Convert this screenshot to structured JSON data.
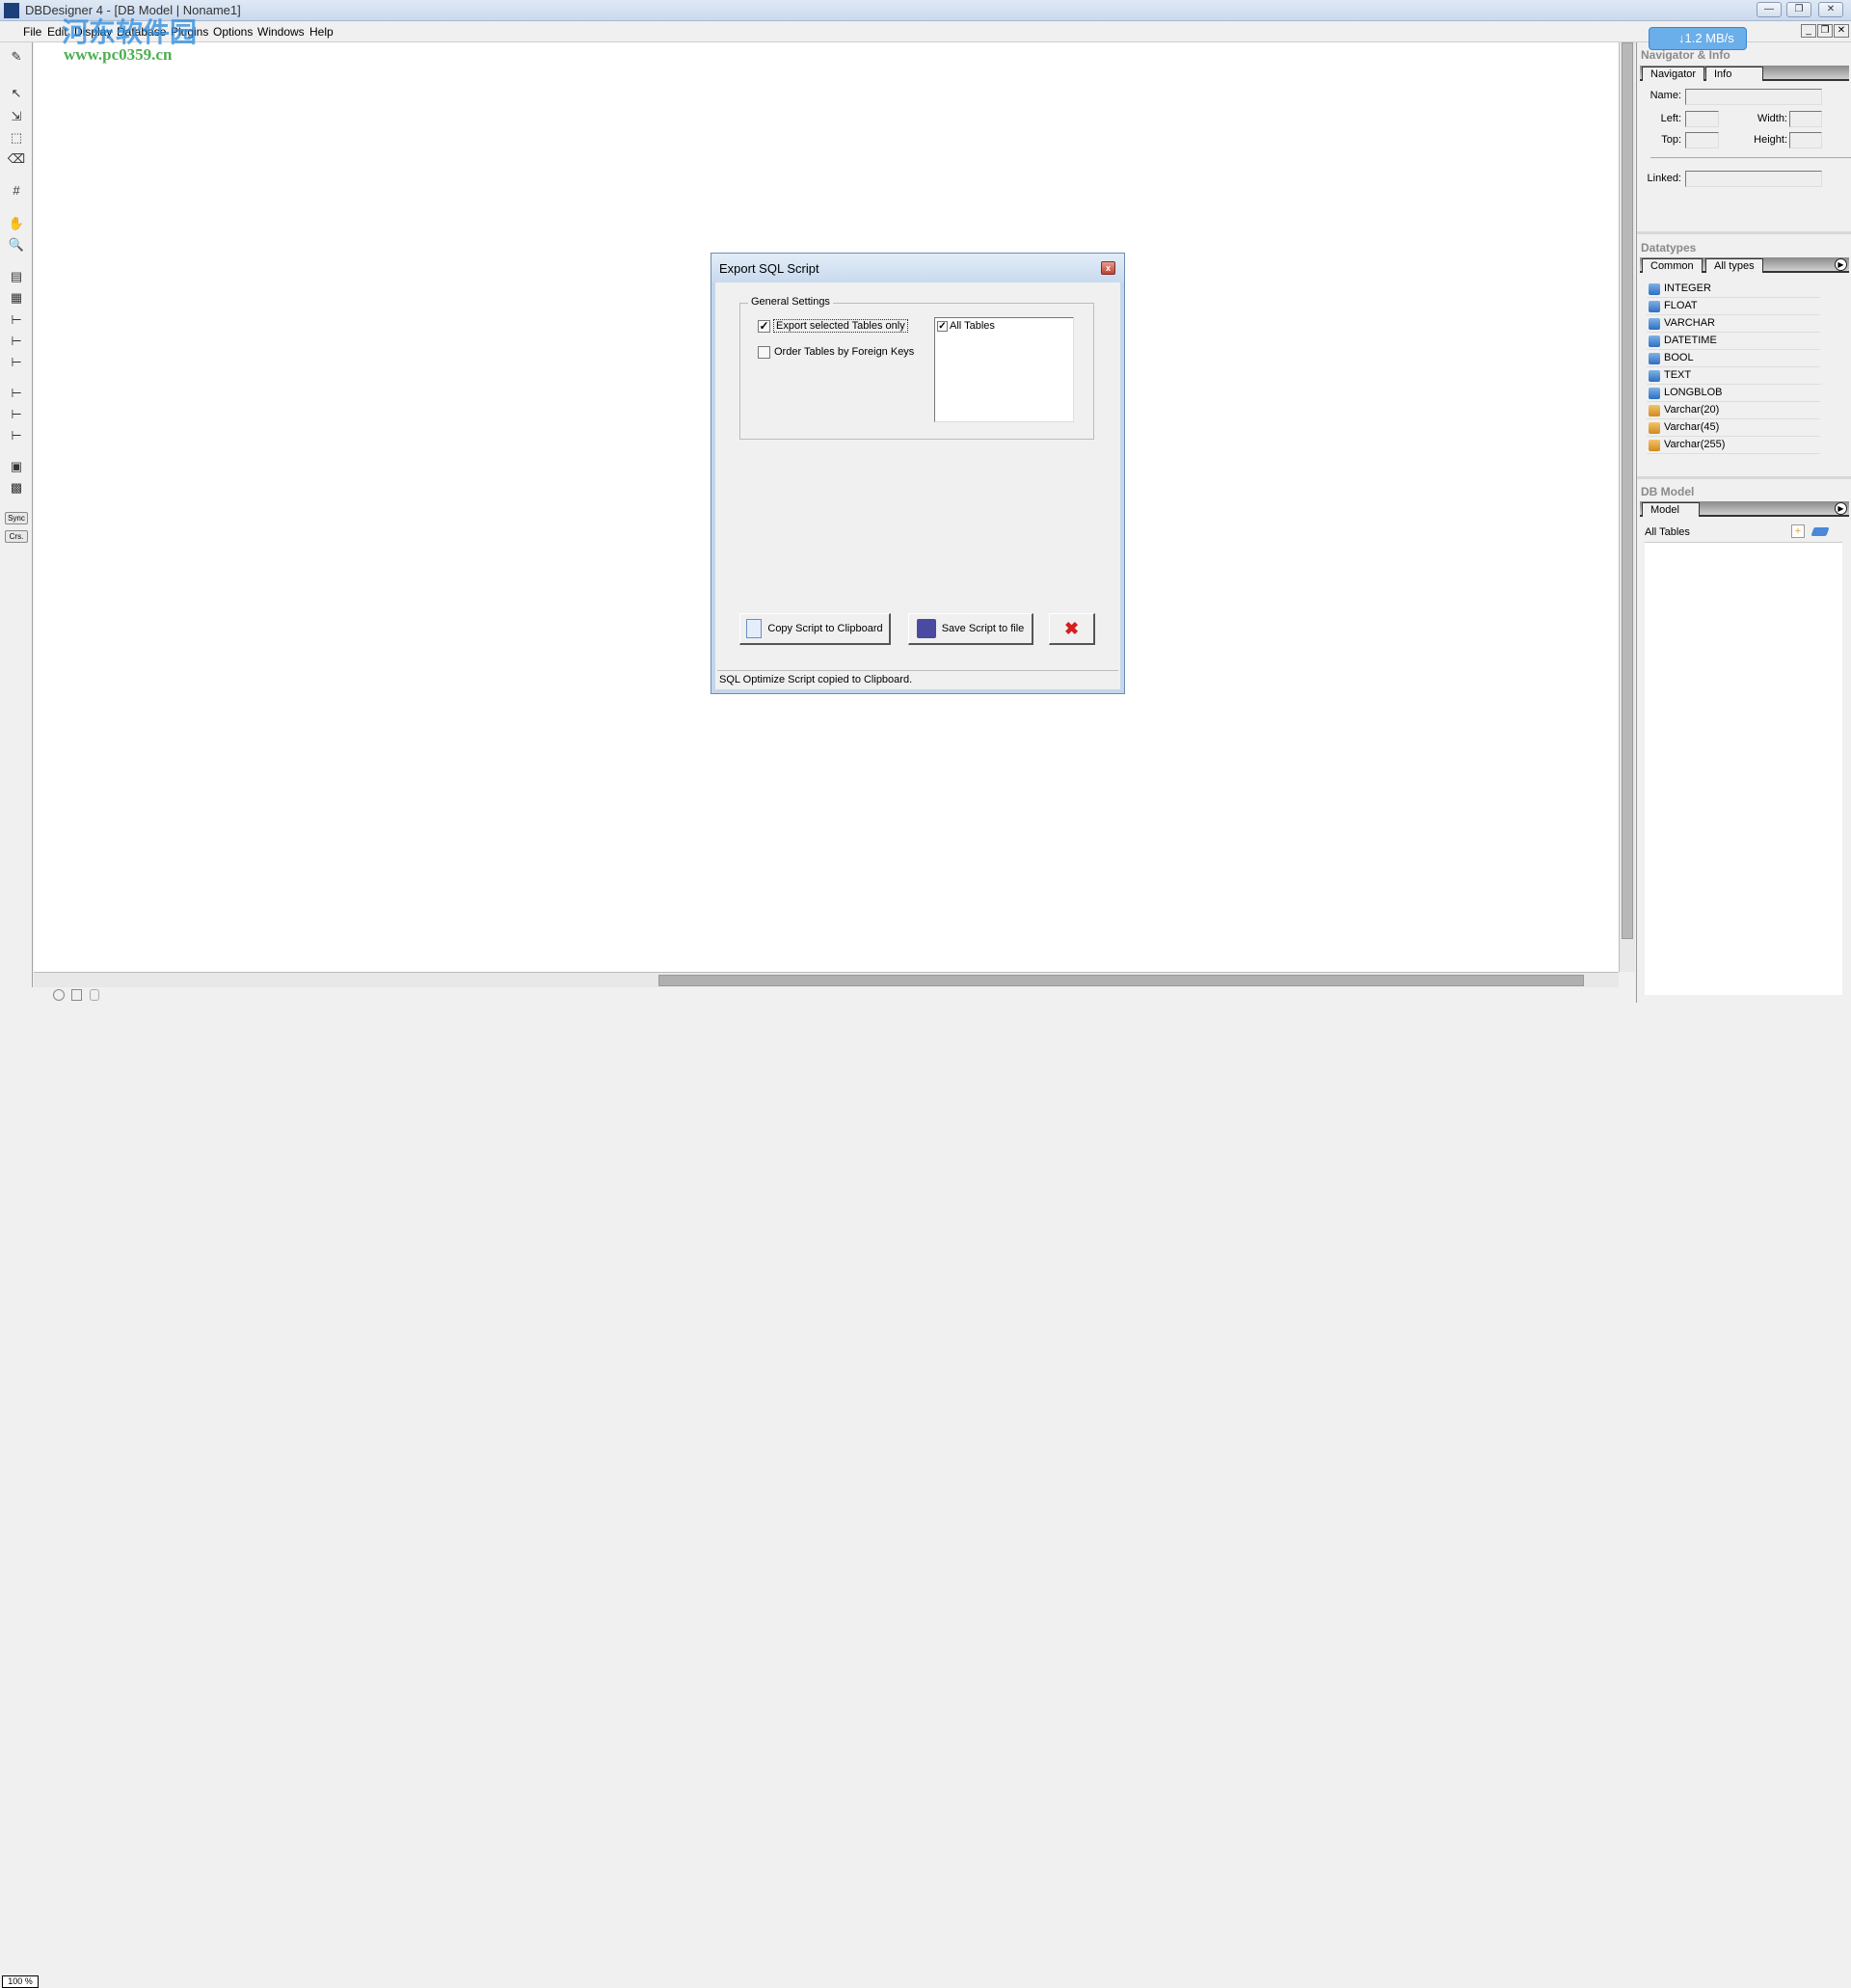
{
  "window": {
    "title": "DBDesigner 4 - [DB Model | Noname1]",
    "min": "—",
    "max": "❐",
    "close": "✕"
  },
  "menu": [
    "File",
    "Edit",
    "Display",
    "Database",
    "Plugins",
    "Options",
    "Windows",
    "Help"
  ],
  "watermark": {
    "text": "河东软件园",
    "url": "www.pc0359.cn"
  },
  "download_badge": "↓1.2 MB/s",
  "toolbar": {
    "sync": "Sync",
    "crs": "Crs."
  },
  "status": {
    "zoom": "100 %"
  },
  "navigator": {
    "header": "Navigator & Info",
    "tabs": [
      "Navigator",
      "Info"
    ],
    "name_label": "Name:",
    "left_label": "Left:",
    "width_label": "Width:",
    "top_label": "Top:",
    "height_label": "Height:",
    "linked_label": "Linked:"
  },
  "datatypes": {
    "header": "Datatypes",
    "tabs": [
      "Common",
      "All types"
    ],
    "items": [
      "INTEGER",
      "FLOAT",
      "VARCHAR",
      "DATETIME",
      "BOOL",
      "TEXT",
      "LONGBLOB",
      "Varchar(20)",
      "Varchar(45)",
      "Varchar(255)"
    ]
  },
  "dbmodel": {
    "header": "DB Model",
    "tab": "Model",
    "all_tables": "All Tables"
  },
  "dialog": {
    "title": "Export SQL Script",
    "group": "General Settings",
    "export_selected": {
      "label": "Export selected Tables only",
      "checked": true
    },
    "order_fk": {
      "label": "Order Tables by Foreign Keys",
      "checked": false
    },
    "tables": [
      {
        "label": "All Tables",
        "checked": true
      }
    ],
    "copy_button": "Copy Script to Clipboard",
    "save_button": "Save Script to file",
    "status": "SQL Optimize Script copied to Clipboard."
  },
  "colors": {
    "accent": "#c8daee",
    "close_red": "#d42020",
    "watermark_green": "#4caf50",
    "watermark_blue": "#2a8be0"
  }
}
